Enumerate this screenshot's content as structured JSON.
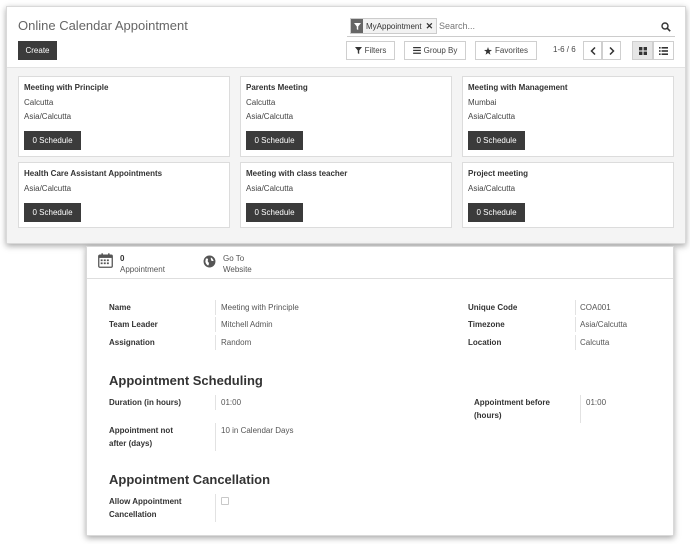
{
  "kanban": {
    "title": "Online Calendar Appointment",
    "search": {
      "facet_value": "MyAppointment",
      "placeholder": "Search..."
    },
    "create_label": "Create",
    "filters_label": "Filters",
    "groupby_label": "Group By",
    "favorites_label": "Favorites",
    "pager": "1-6 / 6",
    "cards": [
      {
        "title": "Meeting with Principle",
        "line1": "Calcutta",
        "line2": "Asia/Calcutta",
        "button": "0 Schedule"
      },
      {
        "title": "Parents Meeting",
        "line1": "Calcutta",
        "line2": "Asia/Calcutta",
        "button": "0 Schedule"
      },
      {
        "title": "Meeting with Management",
        "line1": "Mumbai",
        "line2": "Asia/Calcutta",
        "button": "0 Schedule"
      },
      {
        "title": "Health Care Assistant Appointments",
        "line1": "Asia/Calcutta",
        "line2": "",
        "button": "0 Schedule"
      },
      {
        "title": "Meeting with class teacher",
        "line1": "Asia/Calcutta",
        "line2": "",
        "button": "0 Schedule"
      },
      {
        "title": "Project meeting",
        "line1": "Asia/Calcutta",
        "line2": "",
        "button": "0 Schedule"
      }
    ]
  },
  "form": {
    "smart_buttons": {
      "appointment_count": "0",
      "appointment_label": "Appointment",
      "website_line1": "Go To",
      "website_line2": "Website"
    },
    "fields": {
      "name_label": "Name",
      "name_value": "Meeting with Principle",
      "leader_label": "Team Leader",
      "leader_value": "Mitchell Admin",
      "assign_label": "Assignation",
      "assign_value": "Random",
      "code_label": "Unique Code",
      "code_value": "COA001",
      "tz_label": "Timezone",
      "tz_value": "Asia/Calcutta",
      "loc_label": "Location",
      "loc_value": "Calcutta"
    },
    "scheduling": {
      "title": "Appointment Scheduling",
      "duration_label": "Duration (in hours)",
      "duration_value": "01:00",
      "before_label_1": "Appointment before",
      "before_label_2": "(hours)",
      "before_value": "01:00",
      "notafter_label_1": "Appointment not",
      "notafter_label_2": "after (days)",
      "notafter_value": "10 in Calendar Days"
    },
    "cancellation": {
      "title": "Appointment Cancellation",
      "allow_label_1": "Allow Appointment",
      "allow_label_2": "Cancellation",
      "allow_checked": false
    }
  }
}
